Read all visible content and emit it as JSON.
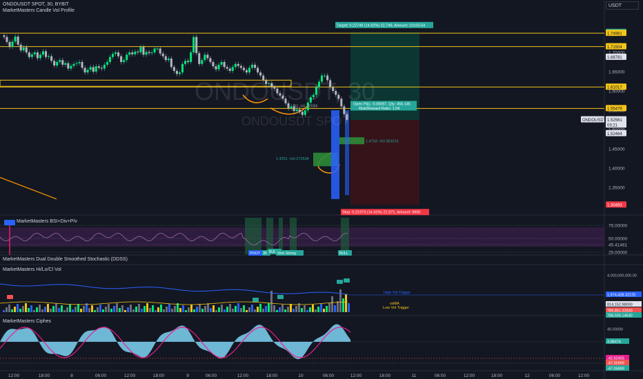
{
  "header": {
    "title": "ONDOUSDT SPOT, 30, BYBIT",
    "indicator": "MarketMasters Candle Vol Profile",
    "currency_button": "USDT"
  },
  "watermark": {
    "big": "ONDOUSDT, 30",
    "small": "ONDOUSDT SPOT"
  },
  "panes": {
    "rsi": "MarketMasters BSI+Div+P/v",
    "stoch": "MarketMasters Dual Double Smoothed Stochastic (DDSS)",
    "vol": "MarketMasters Hi/Lo/Cl Vol",
    "cipher": "MarketMasters Ciphes"
  },
  "colors": {
    "bg": "#131722",
    "up": "#26a69a",
    "up_bright": "#00e676",
    "down": "#ef5350",
    "level": "#f5c518",
    "profit": "#0b3a33",
    "loss": "#3b1318"
  },
  "chart_data": {
    "type": "candlestick",
    "symbol": "ONDOUSDT",
    "interval": "30",
    "exchange": "BYBIT",
    "x_ticks": [
      "12:00",
      "18:00",
      "8",
      "06:00",
      "12:00",
      "18:00",
      "9",
      "06:00",
      "12:00",
      "18:00",
      "10",
      "06:00",
      "12:00",
      "18:00",
      "11",
      "06:00",
      "12:00",
      "18:00",
      "12",
      "06:00",
      "12:00"
    ],
    "price_ticks": [
      "1.75000",
      "1.70000",
      "1.65000",
      "1.60000",
      "1.55000",
      "1.50000",
      "1.45000",
      "1.40000",
      "1.35000"
    ],
    "price_range": [
      1.3,
      1.8
    ],
    "horizontal_levels": [
      1.74981,
      1.71504,
      1.61017,
      1.55479
    ],
    "price_labels": [
      {
        "text": "1.75213",
        "kind": "target"
      },
      {
        "text": "1.74981",
        "kind": "level"
      },
      {
        "text": "1.71504",
        "kind": "level"
      },
      {
        "text": "1.68781",
        "kind": "plain"
      },
      {
        "text": "1.61017",
        "kind": "level"
      },
      {
        "text": "1.55479",
        "kind": "level"
      },
      {
        "text": "1.52561",
        "kind": "last"
      },
      {
        "text": "03:21",
        "kind": "timer"
      },
      {
        "text": "1.52464",
        "kind": "plain"
      },
      {
        "text": "1.30493",
        "kind": "stop"
      }
    ],
    "last_price_symbol": "ONDOUSDT",
    "position": {
      "target": "Target: 0.22749 (14.92%) 22,749, Amount: 10103.54",
      "open": "Open P&L: 0.00097, Qty: 455.145",
      "rr": "Risk/Reward Ratio: 1.04",
      "stop": "Stop: 0.21973 (14.41%) 21,971, Amount: 9900",
      "target_price": 1.75213,
      "entry_price": 1.52464,
      "stop_price": 1.30493
    },
    "volume_profile": [
      {
        "label": "1.4703 -Vol 363315",
        "price": 1.4703
      },
      {
        "label": "1.4251 -Vol 272534",
        "price": 1.4251
      },
      {
        "label": "162 -Vol 133085",
        "price": 1.56
      }
    ],
    "rsi_ticks": [
      "75.00000",
      "50.00000",
      "45.41481",
      "25.00000"
    ],
    "rsi_labels": [
      "PIVOT",
      "BI",
      "BULL",
      "Strong",
      "Strong",
      "BULL"
    ],
    "vol_ticks": [
      "4,000,000,000.00",
      "1,974,428.32125",
      "814,152.98000",
      "789,851.32930",
      "788,506.14630"
    ],
    "vol_labels": [
      "High Vol Trigger",
      "volMA",
      "Low Vol Trigger"
    ],
    "cipher_ticks": [
      "40.00000",
      "4.88476",
      "-42.62455",
      "-47.05899",
      "-47.05899"
    ],
    "prices": [
      1.74,
      1.727,
      1.714,
      1.728,
      1.741,
      1.72,
      1.705,
      1.713,
      1.7,
      1.688,
      1.695,
      1.7,
      1.685,
      1.694,
      1.703,
      1.688,
      1.69,
      1.678,
      1.666,
      1.675,
      1.68,
      1.668,
      1.672,
      1.658,
      1.665,
      1.67,
      1.672,
      1.675,
      1.66,
      1.648,
      1.655,
      1.662,
      1.65,
      1.664,
      1.66,
      1.658,
      1.668,
      1.675,
      1.688,
      1.696,
      1.7,
      1.69,
      1.675,
      1.68,
      1.694,
      1.7,
      1.695,
      1.702,
      1.7,
      1.714,
      1.694,
      1.701,
      1.698,
      1.7,
      1.71,
      1.71,
      1.697,
      1.69,
      1.68,
      1.684,
      1.662,
      1.652,
      1.644,
      1.648,
      1.67,
      1.678,
      1.675,
      1.7,
      1.74,
      1.698,
      1.67,
      1.68,
      1.694,
      1.685,
      1.675,
      1.664,
      1.656,
      1.668,
      1.675,
      1.662,
      1.658,
      1.652,
      1.662,
      1.67,
      1.665,
      1.66,
      1.654,
      1.648,
      1.66,
      1.668,
      1.66,
      1.648,
      1.64,
      1.628,
      1.618,
      1.62,
      1.61,
      1.606,
      1.594,
      1.588,
      1.58,
      1.568,
      1.555,
      1.56,
      1.548,
      1.552,
      1.546,
      1.538,
      1.55,
      1.57,
      1.584,
      1.59,
      1.61,
      1.624,
      1.64,
      1.64,
      1.628,
      1.61,
      1.6,
      1.59,
      1.58,
      1.56,
      1.54,
      1.525
    ]
  }
}
